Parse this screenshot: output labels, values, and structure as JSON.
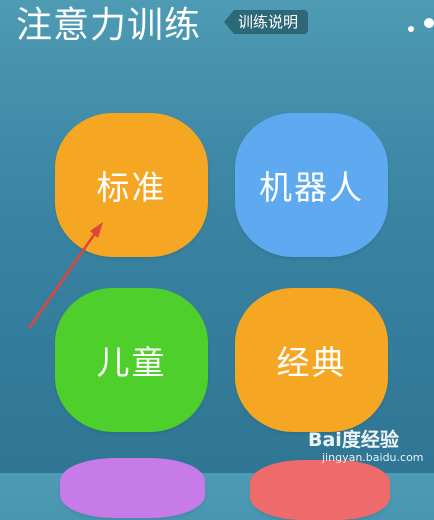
{
  "header": {
    "title": "注意力训练",
    "help_label": "训练说明"
  },
  "modes": [
    {
      "label": "标准",
      "color": "#f5a623"
    },
    {
      "label": "机器人",
      "color": "#5ea9f0"
    },
    {
      "label": "儿童",
      "color": "#4fcf2c"
    },
    {
      "label": "经典",
      "color": "#f5a623"
    },
    {
      "label": "",
      "color": "#c77be8"
    },
    {
      "label": "",
      "color": "#ef6a6a"
    }
  ],
  "annotation": {
    "arrow_color": "#e0443a"
  },
  "watermark": {
    "brand": "Bai度经验",
    "url": "jingyan.baidu.com"
  }
}
